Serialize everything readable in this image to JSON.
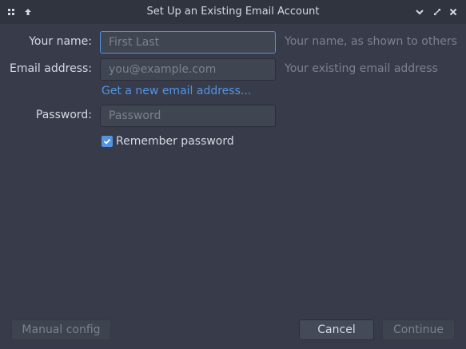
{
  "window": {
    "title": "Set Up an Existing Email Account",
    "left_icons": [
      "grid-icon",
      "pin-up-icon"
    ],
    "right_icons": [
      "minimize-icon",
      "maximize-icon",
      "close-icon"
    ]
  },
  "form": {
    "name": {
      "label": "Your name:",
      "placeholder": "First Last",
      "value": "",
      "hint": "Your name, as shown to others"
    },
    "email": {
      "label": "Email address:",
      "placeholder": "you@example.com",
      "value": "",
      "hint": "Your existing email address"
    },
    "new_email_link": "Get a new email address...",
    "password": {
      "label": "Password:",
      "placeholder": "Password",
      "value": ""
    },
    "remember": {
      "label": "Remember password",
      "checked": true
    }
  },
  "buttons": {
    "manual_config": "Manual config",
    "cancel": "Cancel",
    "continue": "Continue"
  },
  "colors": {
    "background": "#383c4a",
    "titlebar": "#2f343f",
    "accent": "#5294e2",
    "text": "#d3dae3",
    "muted": "#7c818c"
  }
}
